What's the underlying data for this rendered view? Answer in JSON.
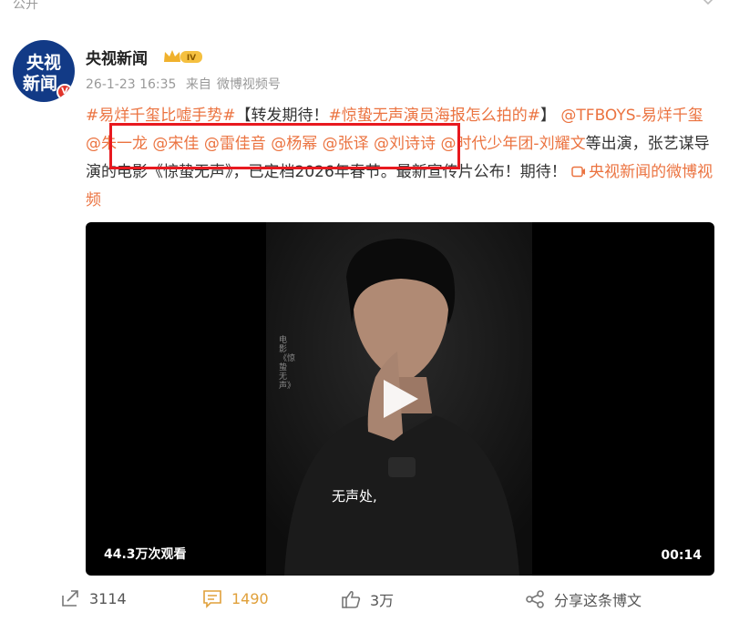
{
  "top": {
    "visibility_label": "公开"
  },
  "account": {
    "avatar_text": "央视新闻",
    "v_badge": "V",
    "name": "央视新闻",
    "level_badge": "IV"
  },
  "meta": {
    "time": "26-1-23 16:35",
    "from_prefix": "来自",
    "source": "微博视频号"
  },
  "post": {
    "tag1": "#易烊千玺比嘘手势#",
    "bracket_text": "【转发期待！",
    "tag2": "#惊蛰无声演员海报怎么拍的#",
    "bracket_close": "】",
    "mention1": "@TFBOYS-易烊千玺",
    "mention2": "@朱一龙",
    "mention3": "@宋佳",
    "mention4": "@雷佳音",
    "mention5": "@杨幂",
    "mention6": "@张译",
    "mention7": "@刘诗诗",
    "mention8": "@时代少年团-刘耀文",
    "body": "等出演，张艺谋导演的电影《惊蛰无声》，已定档2026年春节。最新宣传片公布！期待！",
    "video_link": "央视新闻的微博视频"
  },
  "video": {
    "views": "44.3万次观看",
    "duration": "00:14",
    "subtitle": "无声处,",
    "side_caption": "电影《惊蛰无声》"
  },
  "actions": {
    "repost_count": "3114",
    "comment_count": "1490",
    "like_count": "3万",
    "share_label": "分享这条博文"
  },
  "colors": {
    "link": "#eb7340",
    "highlight_box": "#e8191f",
    "comment": "#e0a03a"
  }
}
